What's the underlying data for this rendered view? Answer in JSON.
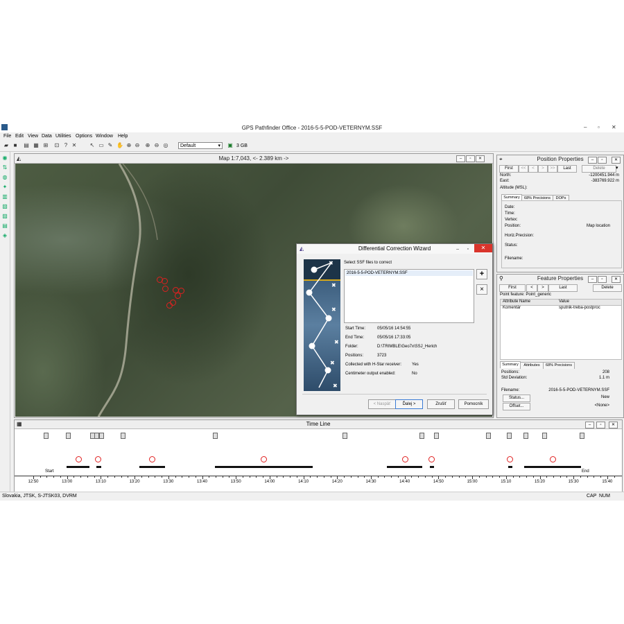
{
  "app": {
    "title": "GPS Pathfinder Office - 2016-5-5-POD-VETERNYM.SSF"
  },
  "menu": [
    "File",
    "Edit",
    "View",
    "Data",
    "Utilities",
    "Options",
    "Window",
    "Help"
  ],
  "toolbar": {
    "layer_select": "Default",
    "storage": "3 GB"
  },
  "map": {
    "title": "Map 1:7,043, <- 2.389 km ->",
    "marker_color": "#e02020"
  },
  "wizard": {
    "title": "Differential Correction Wizard",
    "prompt": "Select SSF files to correct",
    "files": [
      "2016-5-5-POD-VETERNYM.SSF"
    ],
    "add_label": "+",
    "remove_label": "×",
    "fields": [
      {
        "label": "Start Time:",
        "value": "05/05/16 14:54:55"
      },
      {
        "label": "End Time:",
        "value": "05/05/16 17:33:05"
      },
      {
        "label": "Folder:",
        "value": "D:\\TRIMBLE\\Geo7x\\SSJ_Herich"
      },
      {
        "label": "Positions:",
        "value": "3723"
      },
      {
        "label": "Collected with H-Star receiver:",
        "value": "Yes"
      },
      {
        "label": "Centimeter output enabled:",
        "value": "No"
      }
    ],
    "buttons": {
      "back": "< Naspäť",
      "next": "Ďalej >",
      "cancel": "Zrušiť",
      "help": "Pomocník"
    }
  },
  "position_properties": {
    "title": "Position Properties",
    "nav": {
      "first": "First",
      "prev2": "<<",
      "prev": "<",
      "next": ">",
      "next2": ">>",
      "last": "Last",
      "delete": "Delete"
    },
    "north_label": "North:",
    "north_value": "-1200451.944 m",
    "east_label": "East:",
    "east_value": "-383769.922 m",
    "altitude_label": "Altitude (MSL):",
    "tabs": [
      "Summary",
      "68% Precisions",
      "DOPs"
    ],
    "summary": {
      "date": "Date:",
      "time": "Time:",
      "vertex": "Vertex:",
      "position": "Position:",
      "position_value": "Map location",
      "horiz": "Horiz.Precision:",
      "status": "Status:",
      "filename": "Filename:"
    }
  },
  "feature_properties": {
    "title": "Feature Properties",
    "nav": {
      "first": "First",
      "prev": "<",
      "next": ">",
      "last": "Last",
      "delete": "Delete"
    },
    "point_feature": "Point feature: Point_generic",
    "col_name": "Attribute Name",
    "col_value": "Value",
    "rows": [
      {
        "name": "Komentár",
        "value": "sputnik-treba-postproc"
      }
    ],
    "tabs": [
      "Summary",
      "Attributes",
      "68% Precisions"
    ],
    "positions_label": "Positions:",
    "positions_value": "208",
    "std_label": "Std Deviation:",
    "std_value": "1.1 m",
    "filename_label": "Filename:",
    "filename_value": "2016-5-5-POD-VETERNYM.SSF",
    "status_button": "Status...",
    "status_value": "New",
    "offset_button": "Offset...",
    "offset_value": "<None>"
  },
  "timeline": {
    "title": "Time Line",
    "start_label": "Start",
    "end_label": "End",
    "ticks": [
      "12:50",
      "13:00",
      "13:10",
      "13:20",
      "13:30",
      "13:40",
      "13:50",
      "14:00",
      "14:10",
      "14:20",
      "14:30",
      "14:40",
      "14:50",
      "15:00",
      "15:10",
      "15:20",
      "15:30",
      "15:40"
    ]
  },
  "statusbar": {
    "coord_system": "Slovakia, JTSK, S-JTSK03, DVRM",
    "cap": "CAP",
    "num": "NUM"
  }
}
